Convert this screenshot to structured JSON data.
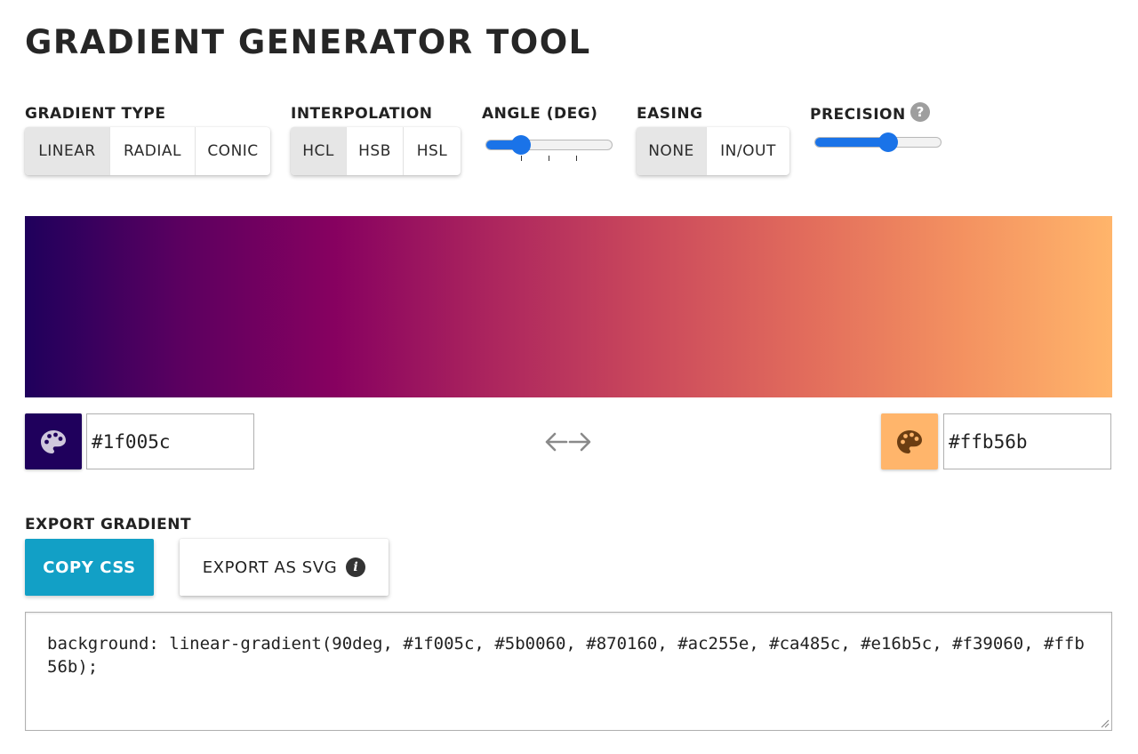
{
  "page": {
    "title": "GRADIENT GENERATOR TOOL"
  },
  "controls": {
    "gradient_type": {
      "label": "GRADIENT TYPE",
      "options": [
        "LINEAR",
        "RADIAL",
        "CONIC"
      ],
      "selected": "LINEAR"
    },
    "interpolation": {
      "label": "INTERPOLATION",
      "options": [
        "HCL",
        "HSB",
        "HSL"
      ],
      "selected": "HCL"
    },
    "angle": {
      "label": "ANGLE (DEG)",
      "level": 0.28
    },
    "easing": {
      "label": "EASING",
      "options": [
        "NONE",
        "IN/OUT"
      ],
      "selected": "NONE"
    },
    "precision": {
      "label": "PRECISION",
      "help_icon": "question-circle-icon",
      "level": 0.58
    }
  },
  "gradient": {
    "colors": [
      "#1f005c",
      "#5b0060",
      "#870160",
      "#ac255e",
      "#ca485c",
      "#e16b5c",
      "#f39060",
      "#ffb56b"
    ]
  },
  "color_stops": {
    "start": {
      "value": "#1f005c",
      "swatch_color": "#1f005c",
      "icon": "palette-icon"
    },
    "end": {
      "value": "#ffb56b",
      "swatch_color": "#ffb56b",
      "icon": "palette-icon"
    },
    "swap_icon": "swap-arrows-icon"
  },
  "export": {
    "label": "EXPORT GRADIENT",
    "copy_label": "COPY CSS",
    "svg_label": "EXPORT AS SVG",
    "info_icon": "info-icon",
    "copy_color": "#12a0c6",
    "css_text": "background: linear-gradient(90deg, #1f005c, #5b0060, #870160, #ac255e, #ca485c, #e16b5c, #f39060, #ffb56b);"
  },
  "accent": "#1a73e8"
}
